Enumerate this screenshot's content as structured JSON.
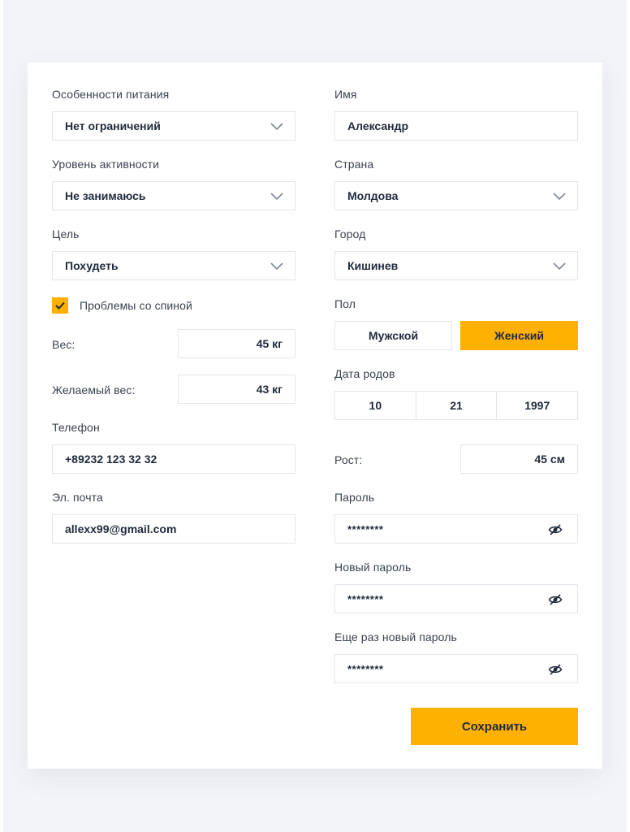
{
  "left": {
    "diet": {
      "label": "Особенности питания",
      "value": "Нет ограничений"
    },
    "activity": {
      "label": "Уровень активности",
      "value": "Не занимаюсь"
    },
    "goal": {
      "label": "Цель",
      "value": "Похудеть"
    },
    "back_problems": {
      "label": "Проблемы со спиной",
      "checked": true
    },
    "weight": {
      "label": "Вес:",
      "value": "45 кг"
    },
    "target_weight": {
      "label": "Желаемый вес:",
      "value": "43 кг"
    },
    "phone": {
      "label": "Телефон",
      "value": "+89232 123 32 32"
    },
    "email": {
      "label": "Эл. почта",
      "value": "allexx99@gmail.com"
    }
  },
  "right": {
    "name": {
      "label": "Имя",
      "value": "Александр"
    },
    "country": {
      "label": "Страна",
      "value": "Молдова"
    },
    "city": {
      "label": "Город",
      "value": "Кишинев"
    },
    "gender": {
      "label": "Пол",
      "male": "Мужской",
      "female": "Женский",
      "selected": "female"
    },
    "birth_date": {
      "label": "Дата родов",
      "day": "10",
      "month": "21",
      "year": "1997"
    },
    "height": {
      "label": "Рост:",
      "value": "45 см"
    },
    "password": {
      "label": "Пароль",
      "value": "********"
    },
    "new_password": {
      "label": "Новый пароль",
      "value": "********"
    },
    "repeat_password": {
      "label": "Еще раз новый пароль",
      "value": "********"
    }
  },
  "save_label": "Сохранить",
  "colors": {
    "accent": "#ffb000",
    "border": "#e2e5ec",
    "text": "#1f2a3c",
    "background": "#f3f4f8"
  },
  "icons": {
    "select": "chevron-down-icon",
    "password": "eye-slash-icon",
    "checkbox": "checkmark-icon"
  }
}
